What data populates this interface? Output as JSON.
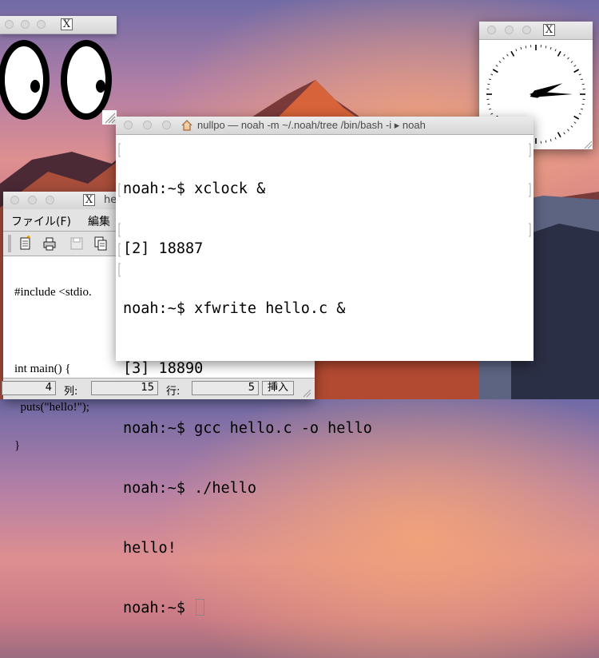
{
  "terminal": {
    "title": "nullpo — noah -m ~/.noah/tree /bin/bash -i ▸ noah",
    "lines": [
      "noah:~$ xclock &",
      "[2] 18887",
      "noah:~$ xfwrite hello.c &",
      "[3] 18890",
      "noah:~$ gcc hello.c -o hello",
      "noah:~$ ./hello",
      "hello!"
    ],
    "prompt": "noah:~$ "
  },
  "editor": {
    "title": "he",
    "menu": {
      "file": "ファイル(F)",
      "edit": "編集"
    },
    "code": [
      "#include <stdio.",
      "",
      "int main() {",
      "  puts(\"hello!\");",
      "}"
    ],
    "status": {
      "first_value": "4",
      "col_label": "列:",
      "col_value": "15",
      "row_label": "行:",
      "row_value": "5",
      "mode": "挿入"
    }
  },
  "xwindow_icon_glyph": "X",
  "clock": {
    "hour": 2,
    "minute": 15
  }
}
